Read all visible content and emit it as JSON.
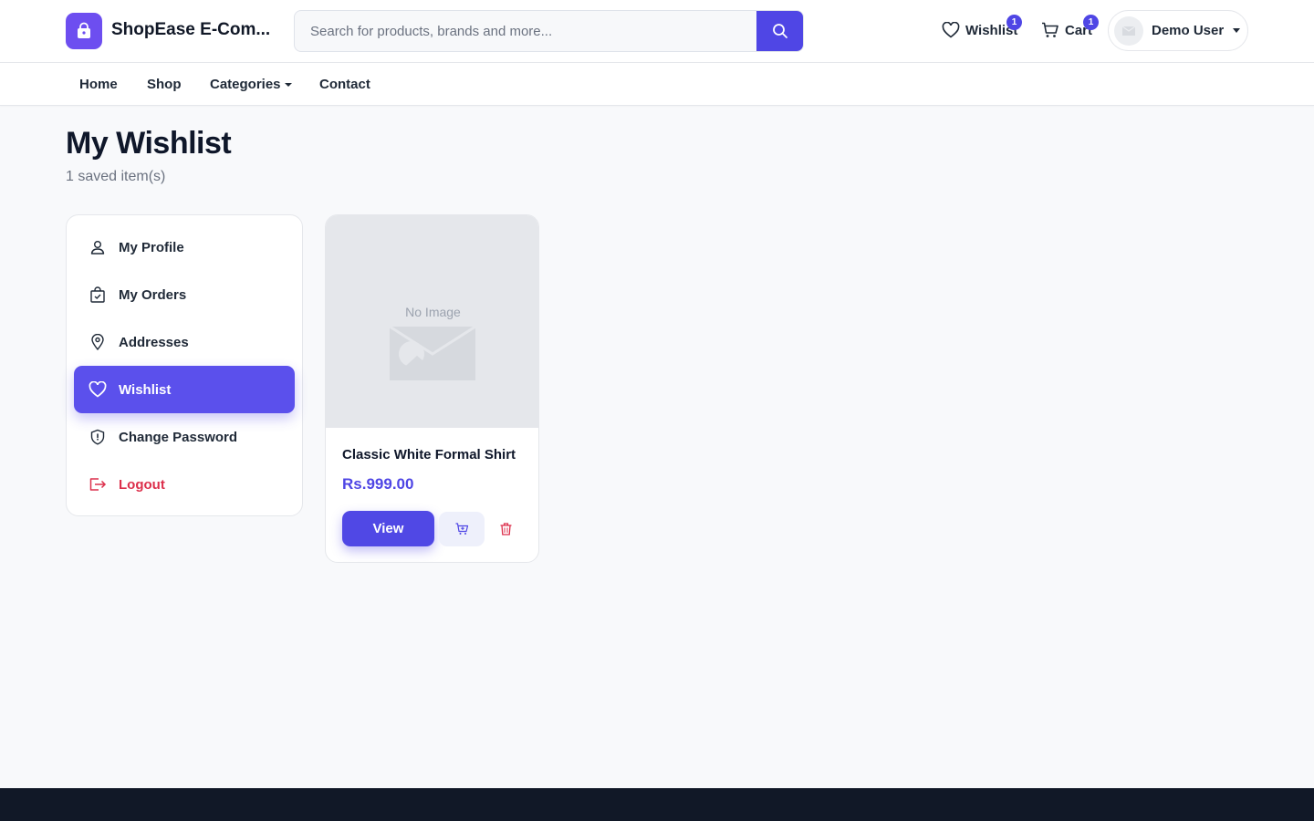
{
  "header": {
    "brand": "ShopEase E-Com...",
    "search_placeholder": "Search for products, brands and more...",
    "wishlist_label": "Wishlist",
    "wishlist_count": "1",
    "cart_label": "Cart",
    "cart_count": "1",
    "user_name": "Demo User"
  },
  "nav": {
    "items": [
      "Home",
      "Shop",
      "Categories",
      "Contact"
    ]
  },
  "page": {
    "title": "My Wishlist",
    "subtitle": "1 saved item(s)"
  },
  "sidebar": {
    "items": [
      {
        "label": "My Profile",
        "icon": "user-icon"
      },
      {
        "label": "My Orders",
        "icon": "bag-check-icon"
      },
      {
        "label": "Addresses",
        "icon": "location-pin-icon"
      },
      {
        "label": "Wishlist",
        "icon": "heart-icon",
        "active": true
      },
      {
        "label": "Change Password",
        "icon": "shield-icon"
      },
      {
        "label": "Logout",
        "icon": "logout-icon"
      }
    ]
  },
  "wishlist": {
    "items": [
      {
        "image_text": "No Image",
        "name": "Classic White Formal Shirt",
        "price": "Rs.999.00",
        "view_label": "View"
      }
    ]
  },
  "colors": {
    "accent": "#4f46e5",
    "logo": "#6d4ef0",
    "danger": "#dc2f4b",
    "footer": "#111827"
  }
}
